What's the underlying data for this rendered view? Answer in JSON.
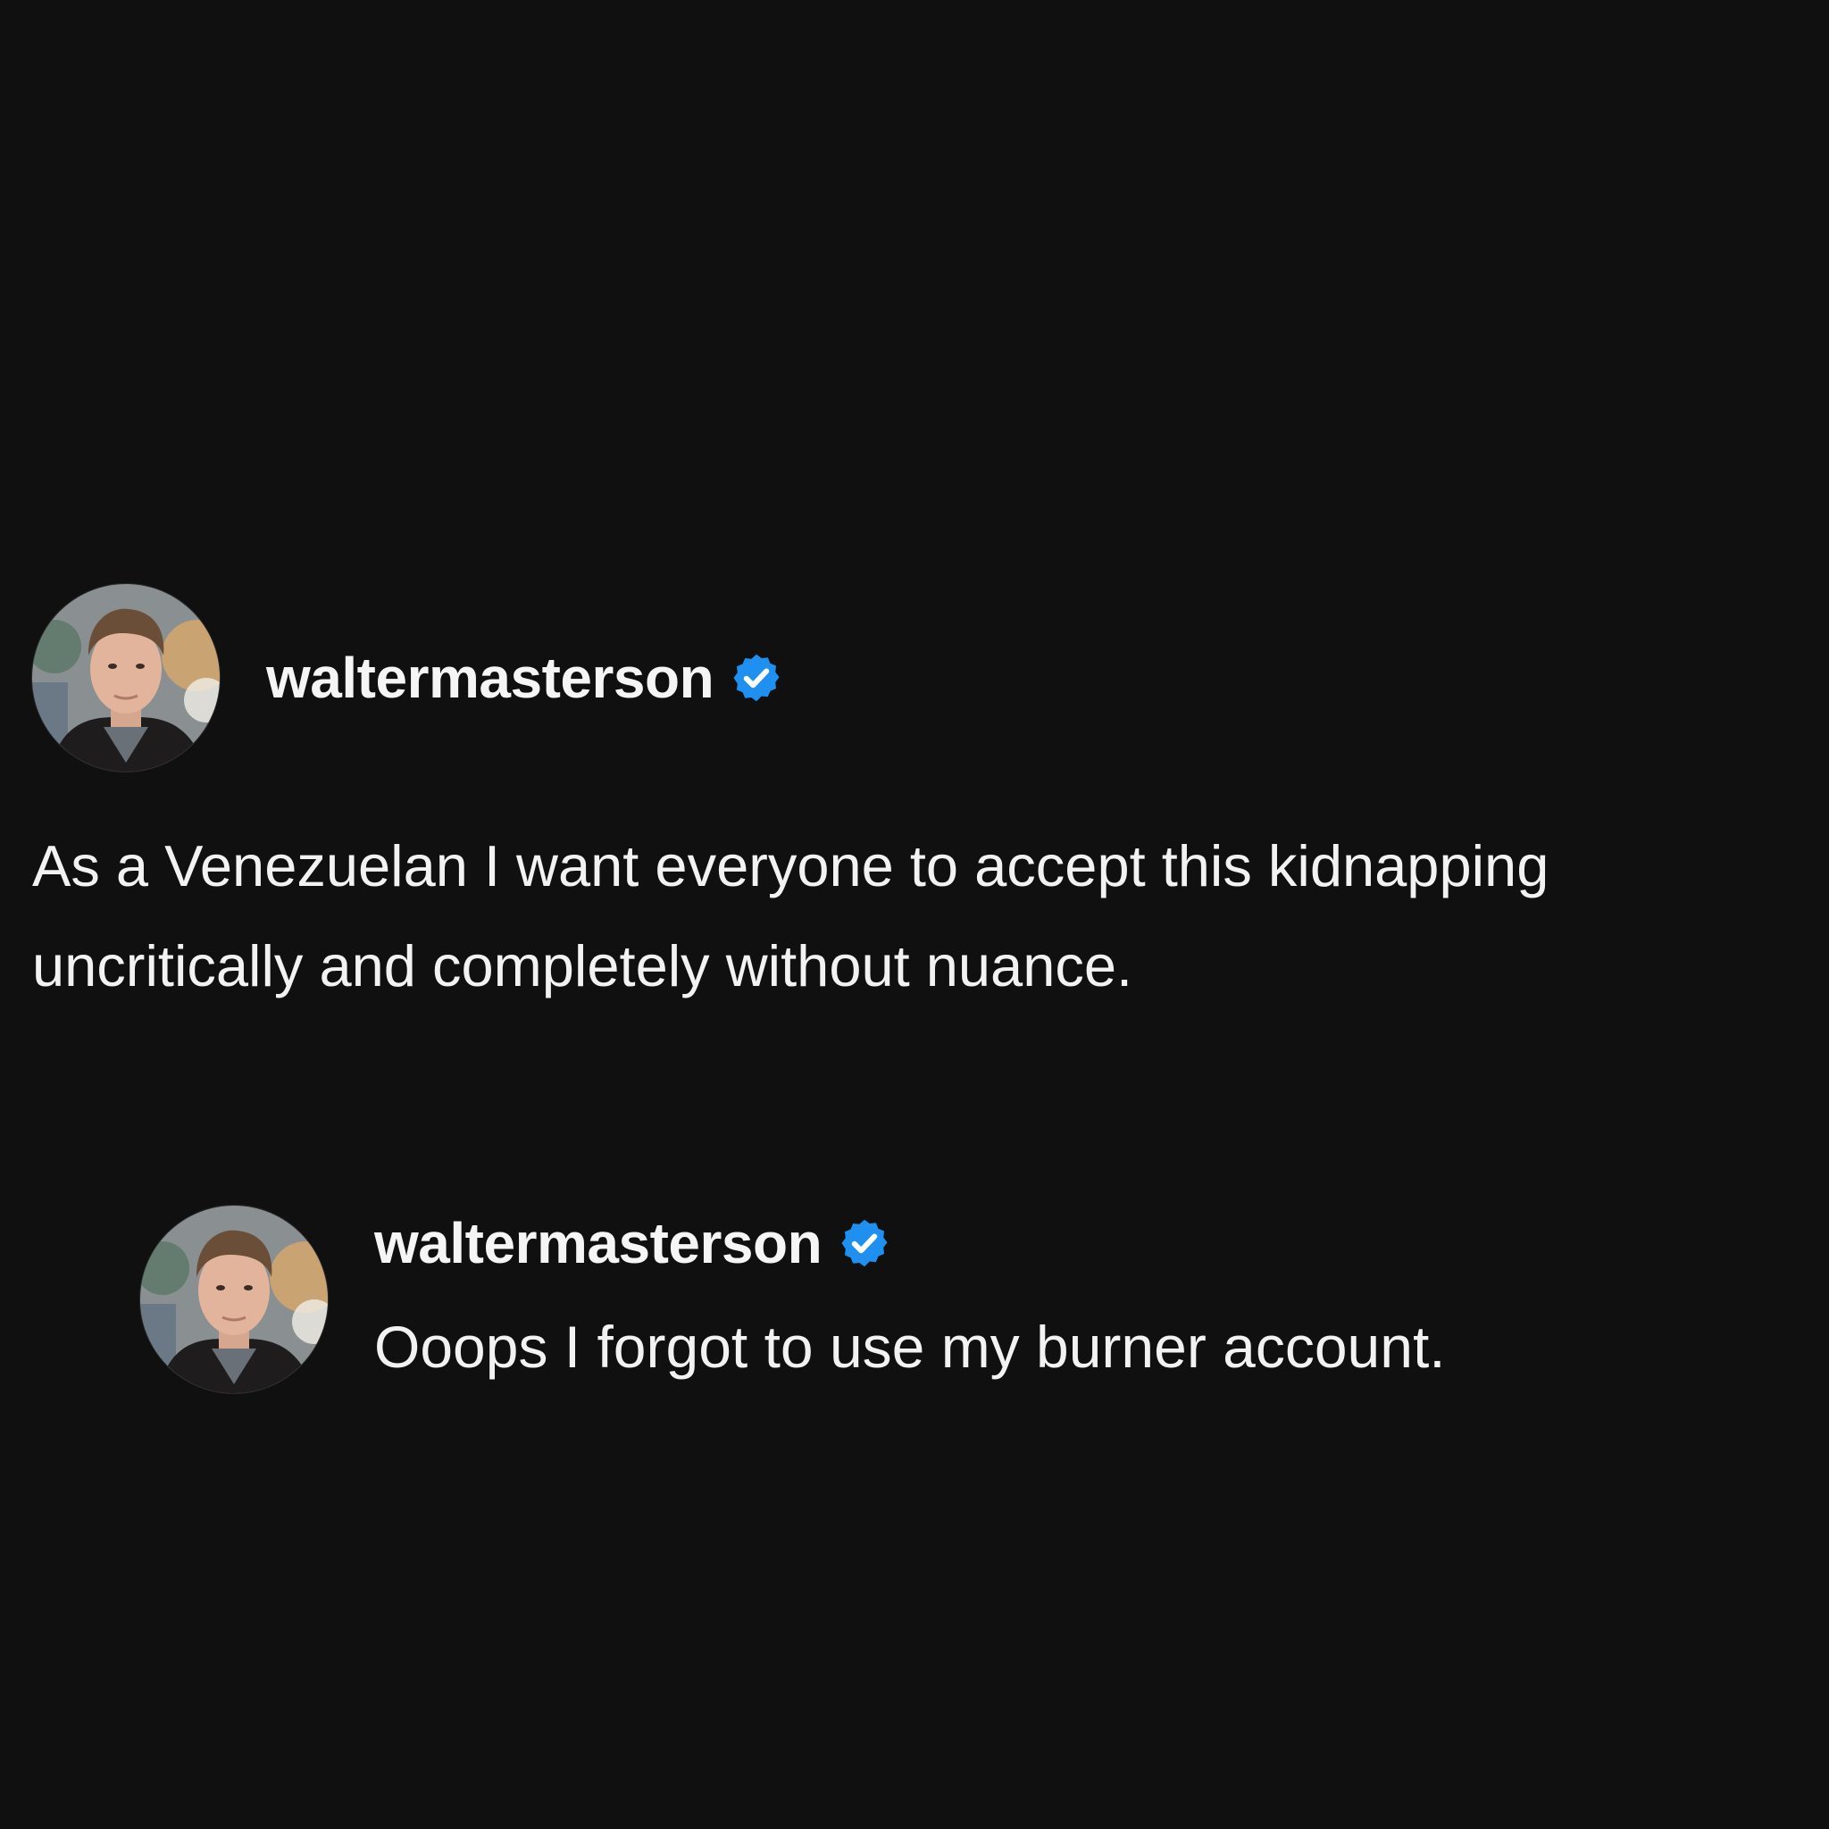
{
  "post": {
    "author": {
      "username": "waltermasterson",
      "verified": true,
      "avatar_icon": "profile-photo",
      "badge_icon": "verified-badge-icon"
    },
    "text": "As a Venezuelan I want everyone to accept this kidnapping uncritically and completely without nuance."
  },
  "reply": {
    "author": {
      "username": "waltermasterson",
      "verified": true,
      "avatar_icon": "profile-photo",
      "badge_icon": "verified-badge-icon"
    },
    "text": "Ooops I forgot to use my burner account."
  },
  "colors": {
    "background": "#101010",
    "text": "#f2f2f2",
    "verified_badge": "#1f8ff0"
  }
}
